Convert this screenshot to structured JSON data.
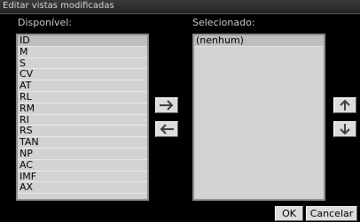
{
  "window": {
    "title": "Editar vistas modificadas"
  },
  "available": {
    "label": "Disponível:",
    "items": [
      "ID",
      "M",
      "S",
      "CV",
      "AT",
      "RL",
      "RM",
      "RI",
      "RS",
      "TAN",
      "NP",
      "AC",
      "IMF",
      "AX"
    ]
  },
  "selected": {
    "label": "Selecionado:",
    "items": [
      "(nenhum)"
    ]
  },
  "buttons": {
    "ok_label": "OK",
    "cancel_label": "Cancelar"
  },
  "icons": {
    "add": "arrow-right-icon",
    "remove": "arrow-left-icon",
    "move_up": "arrow-up-icon",
    "move_down": "arrow-down-icon"
  },
  "colors": {
    "background": "#000000",
    "list_bg": "#d2d2d2",
    "button_bg": "#dcdcdc"
  }
}
